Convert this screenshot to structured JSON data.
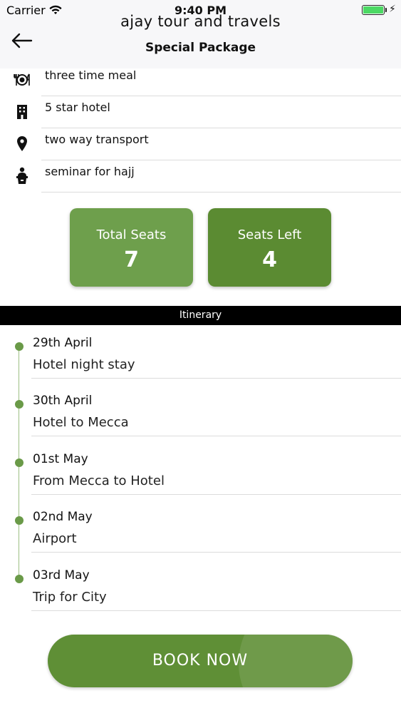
{
  "status_bar": {
    "carrier": "Carrier",
    "time": "9:40 PM",
    "battery_color": "#4cd964"
  },
  "header": {
    "app_title": "ajay tour and travels",
    "page_title": "Special Package",
    "back_icon": "arrow-left-icon"
  },
  "amenities": [
    {
      "icon": "meal-icon",
      "label": "three time meal"
    },
    {
      "icon": "hotel-building-icon",
      "label": "5 star hotel"
    },
    {
      "icon": "location-pin-icon",
      "label": "two way transport"
    },
    {
      "icon": "speaker-podium-icon",
      "label": "seminar for hajj"
    }
  ],
  "seats": {
    "total_label": "Total Seats",
    "total_value": "7",
    "left_label": "Seats Left",
    "left_value": "4"
  },
  "itinerary": {
    "header": "Itinerary",
    "items": [
      {
        "date": "29th April",
        "description": "Hotel night stay"
      },
      {
        "date": "30th April",
        "description": "Hotel to Mecca"
      },
      {
        "date": "01st May",
        "description": "From Mecca to Hotel"
      },
      {
        "date": "02nd May",
        "description": "Airport"
      },
      {
        "date": "03rd May",
        "description": "Trip for City"
      }
    ]
  },
  "book_button": {
    "label": "BOOK NOW"
  },
  "colors": {
    "accent_green": "#5f8f36",
    "card_light_green": "#6e9f4c",
    "card_dark_green": "#5b8b32",
    "timeline_dot": "#6a9a48"
  }
}
